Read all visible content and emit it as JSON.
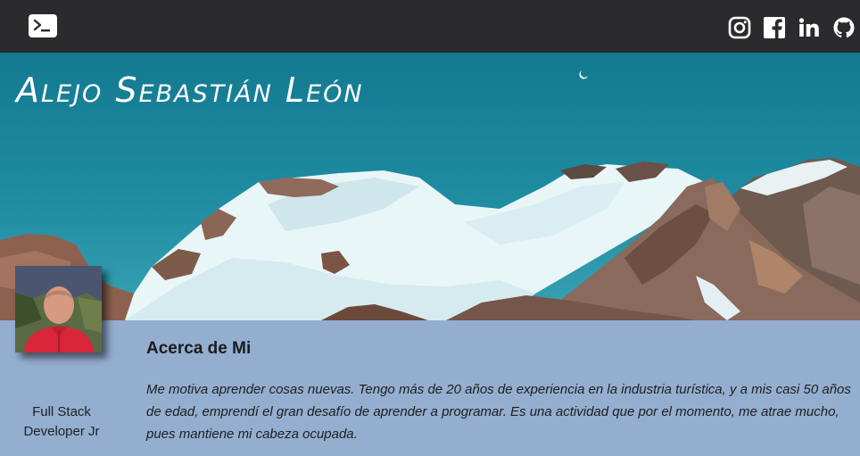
{
  "navbar": {
    "brand_icon": "terminal-icon",
    "social_icons": [
      "instagram-icon",
      "facebook-icon",
      "linkedin-icon",
      "github-icon"
    ]
  },
  "hero": {
    "title": "Alejo Sebastián León"
  },
  "profile": {
    "role_line1": "Full Stack",
    "role_line2": "Developer Jr"
  },
  "about": {
    "heading": "Acerca de Mi",
    "text": "Me motiva aprender cosas nuevas. Tengo más de 20 años de experiencia en la industria turística, y a mis casi 50 años de edad, emprendí el gran desafío de aprender a programar. Es una actividad que por el momento, me atrae mucho, pues mantiene mi cabeza ocupada."
  },
  "colors": {
    "navbar": "#2b2b2d",
    "page_background": "#94aed0",
    "sky": "#1f8ca2"
  }
}
